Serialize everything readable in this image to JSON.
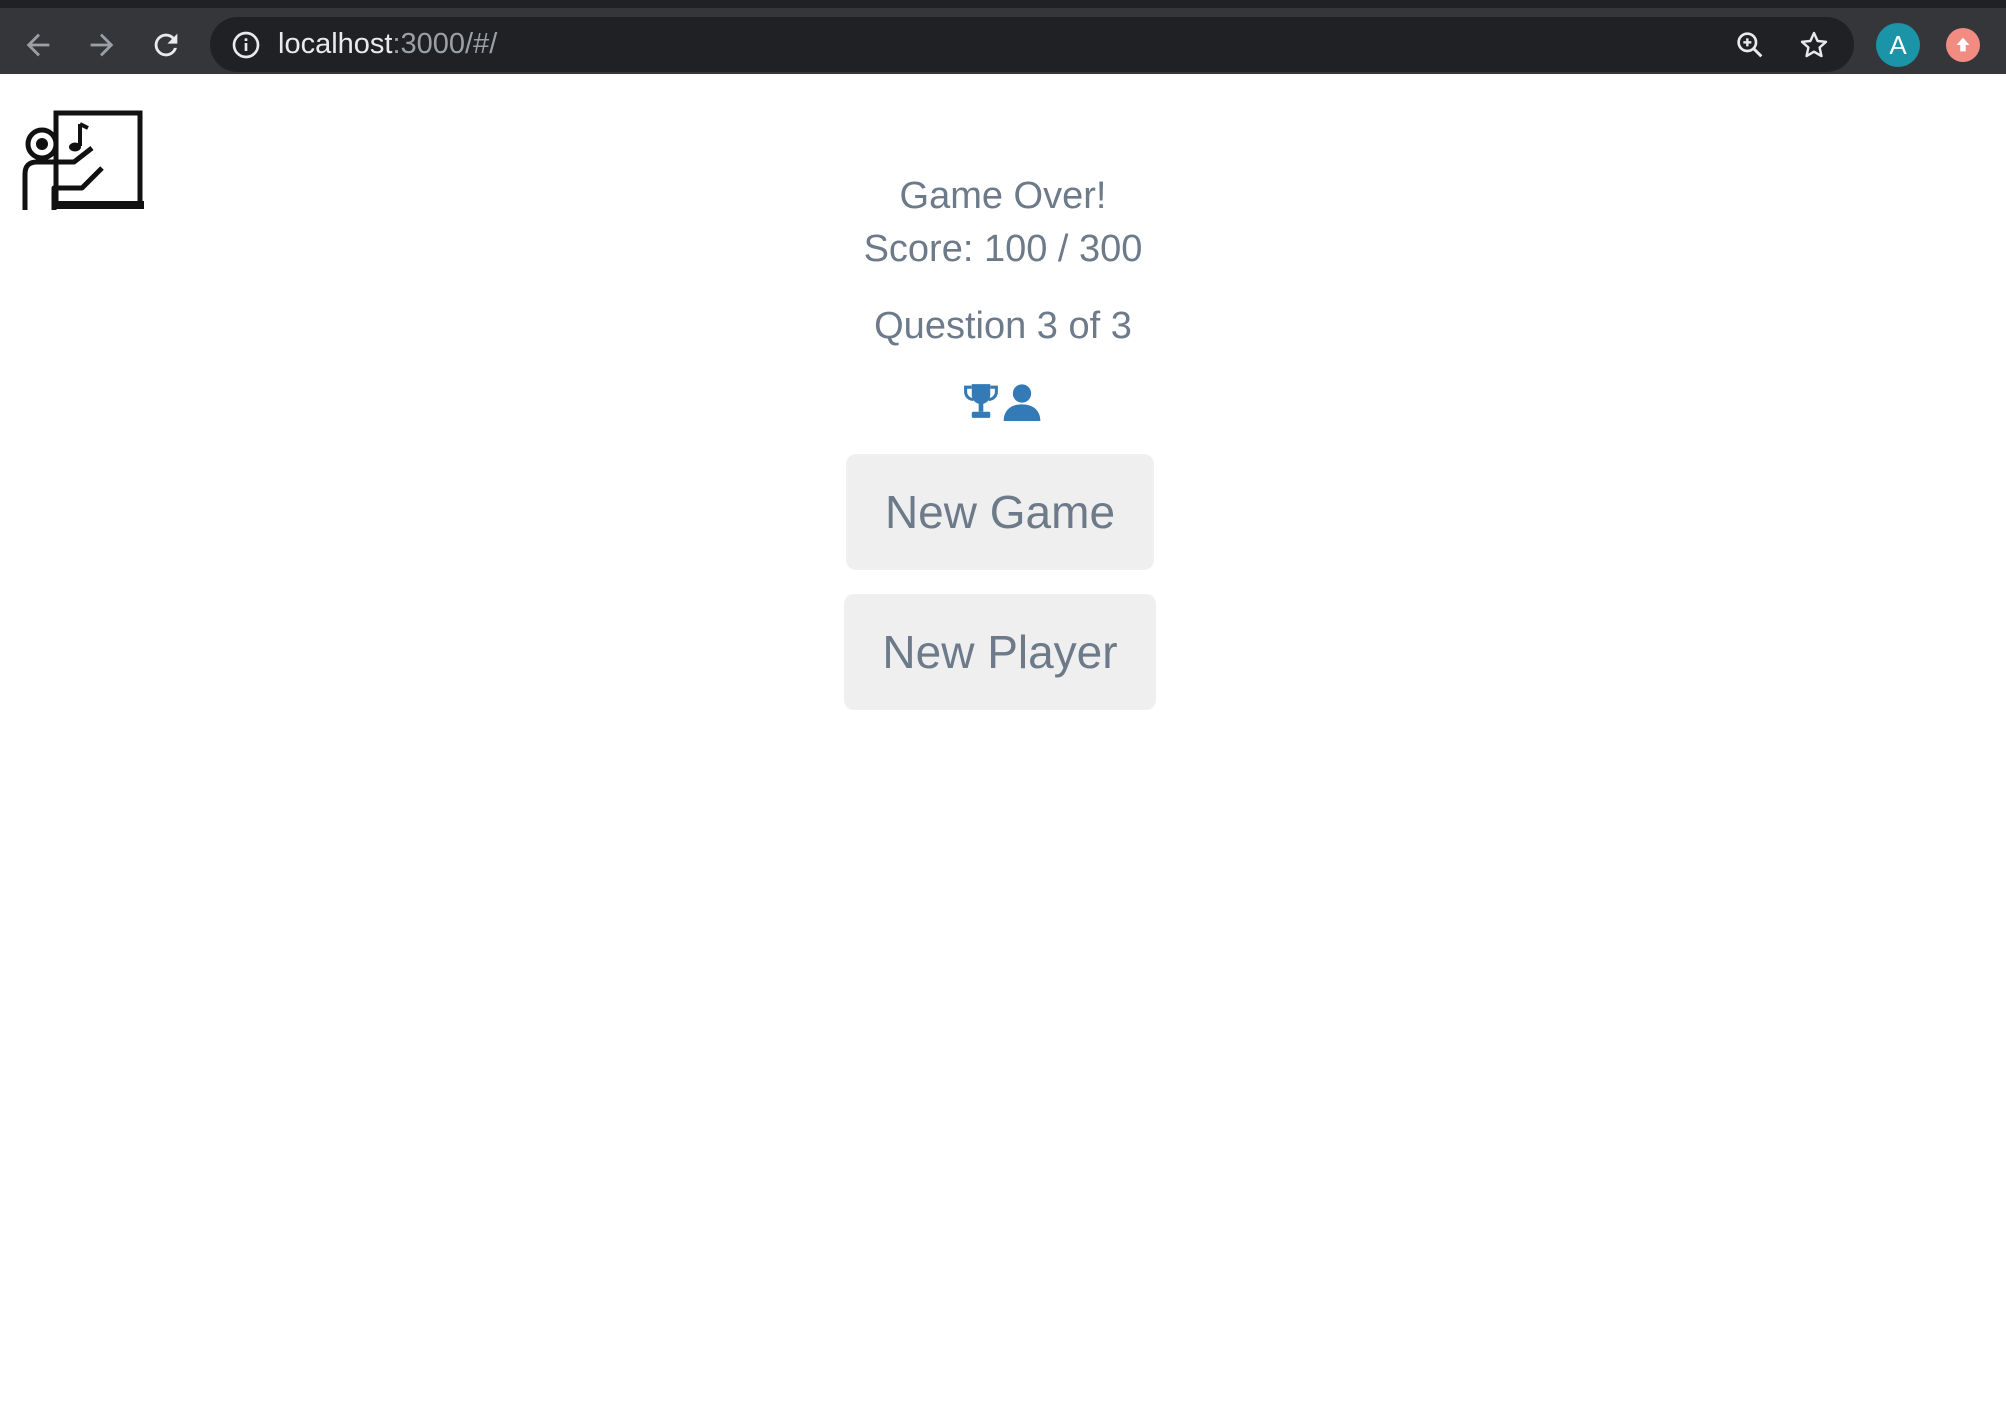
{
  "browser": {
    "url_host": "localhost",
    "url_rest": ":3000/#/",
    "profile_initial": "A",
    "icons": [
      "back-arrow-icon",
      "forward-arrow-icon",
      "reload-icon",
      "info-icon",
      "zoom-icon",
      "star-icon",
      "update-icon"
    ]
  },
  "game": {
    "status": "Game Over!",
    "score": "Score: 100 / 300",
    "progress": "Question 3 of 3",
    "status_icons": [
      "trophy-icon",
      "user-icon"
    ],
    "icon_color": "#337ab7"
  },
  "actions": {
    "new_game": "New Game",
    "new_player": "New Player"
  }
}
